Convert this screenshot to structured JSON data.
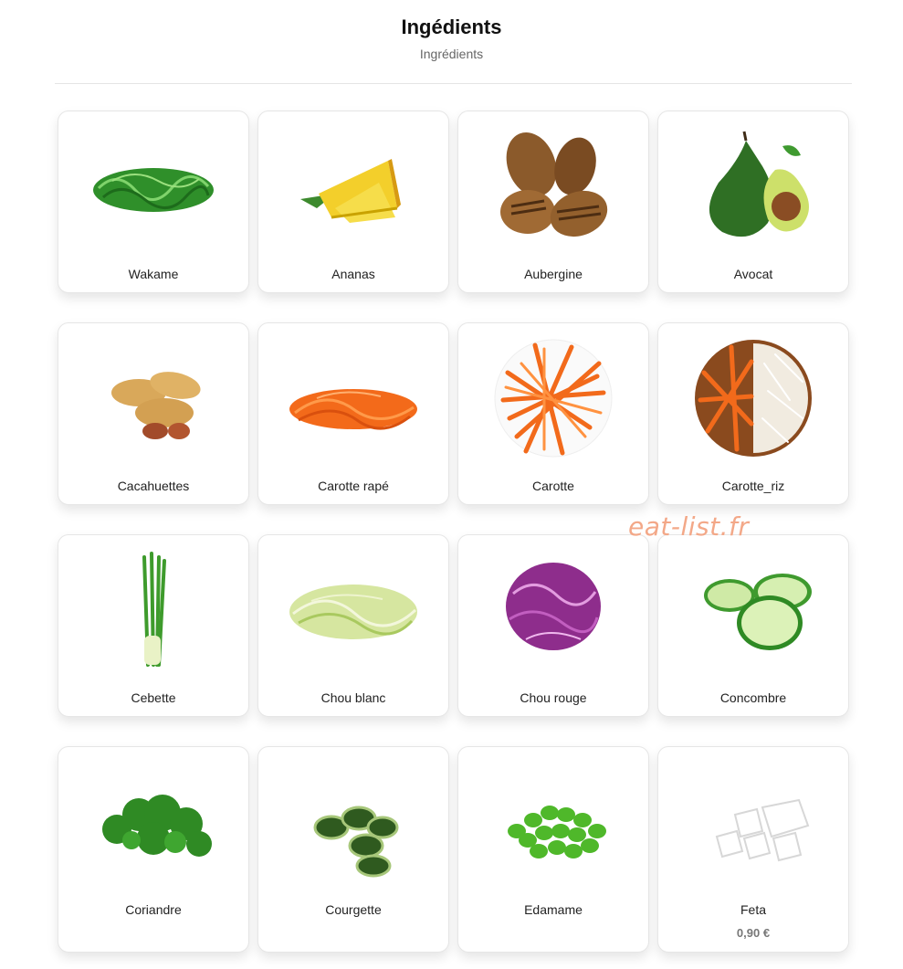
{
  "header": {
    "title": "Ingédients",
    "subtitle": "Ingrédients"
  },
  "watermark": "eat-list.fr",
  "items": [
    {
      "name": "Wakame",
      "icon": "wakame-icon"
    },
    {
      "name": "Ananas",
      "icon": "pineapple-icon"
    },
    {
      "name": "Aubergine",
      "icon": "eggplant-icon"
    },
    {
      "name": "Avocat",
      "icon": "avocado-icon"
    },
    {
      "name": "Cacahuettes",
      "icon": "peanuts-icon"
    },
    {
      "name": "Carotte rapé",
      "icon": "grated-carrot-icon"
    },
    {
      "name": "Carotte",
      "icon": "carrot-icon"
    },
    {
      "name": "Carotte_riz",
      "icon": "carrot-rice-icon"
    },
    {
      "name": "Cebette",
      "icon": "spring-onion-icon"
    },
    {
      "name": "Chou blanc",
      "icon": "white-cabbage-icon"
    },
    {
      "name": "Chou rouge",
      "icon": "red-cabbage-icon"
    },
    {
      "name": "Concombre",
      "icon": "cucumber-icon"
    },
    {
      "name": "Coriandre",
      "icon": "coriander-icon"
    },
    {
      "name": "Courgette",
      "icon": "zucchini-icon"
    },
    {
      "name": "Edamame",
      "icon": "edamame-icon"
    },
    {
      "name": "Feta",
      "icon": "feta-icon",
      "price": "0,90 €"
    }
  ]
}
